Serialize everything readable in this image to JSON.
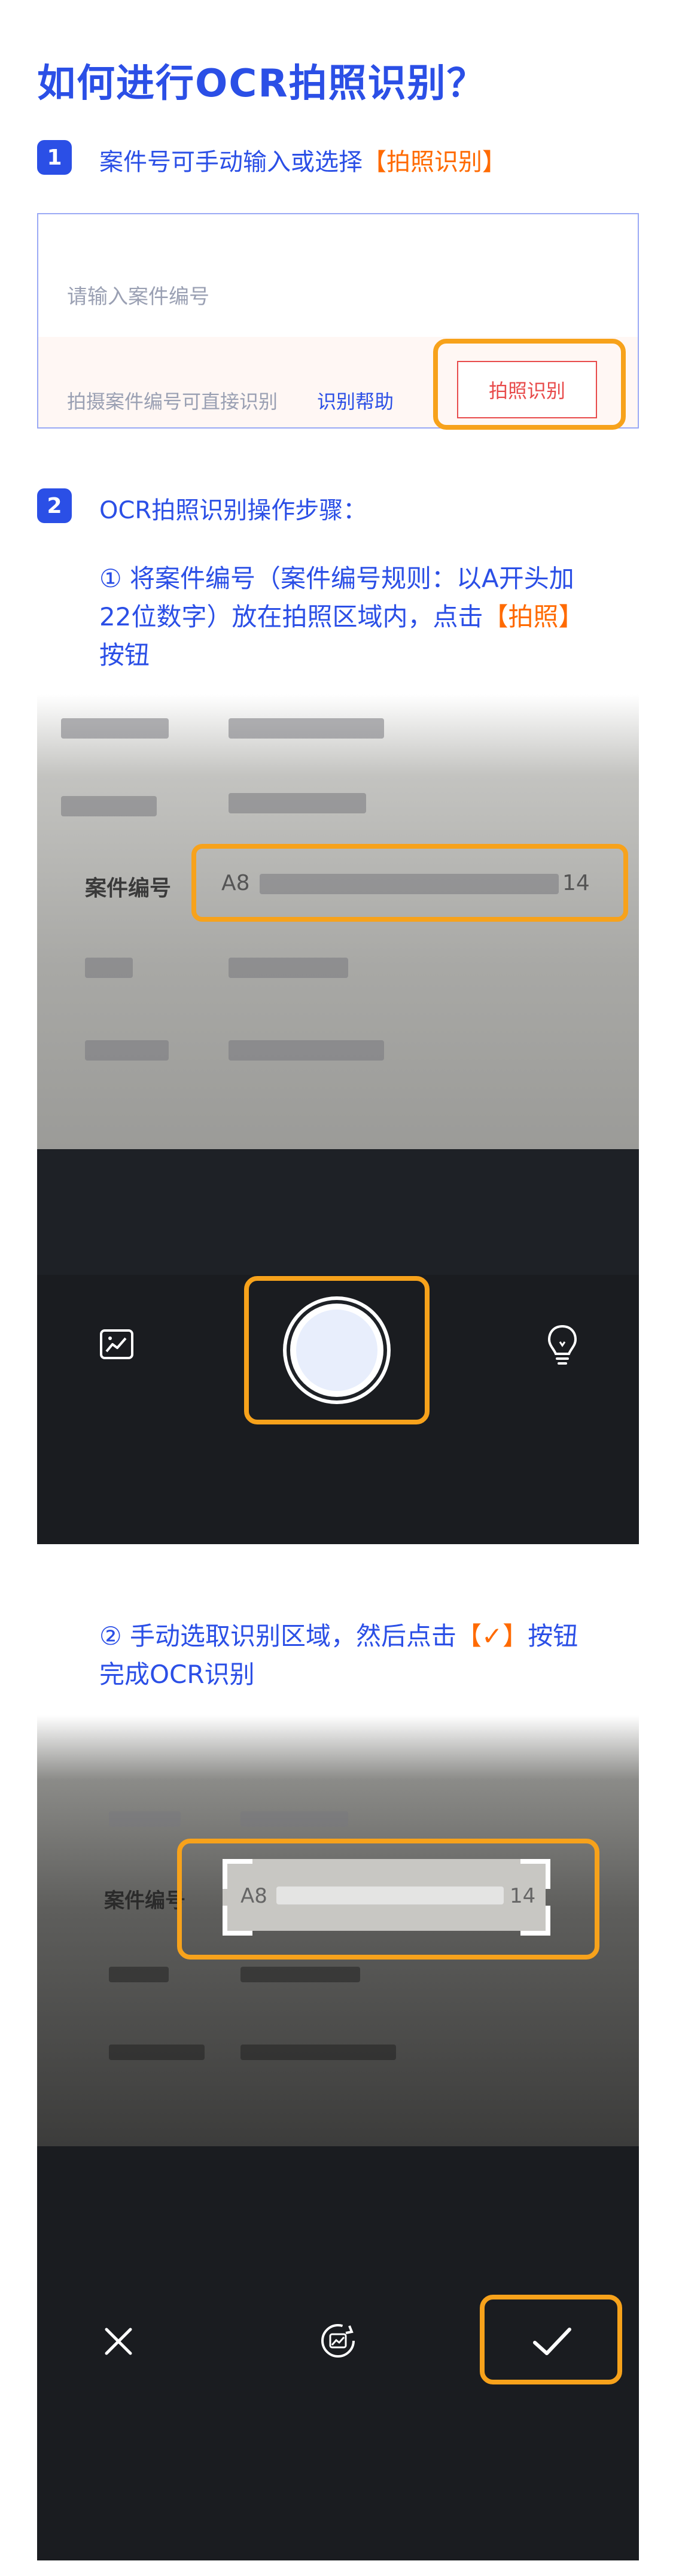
{
  "title": "如何进行OCR拍照识别？",
  "step1": {
    "badge": "1",
    "text_prefix": "案件号可手动输入或选择",
    "text_highlight": "【拍照识别】"
  },
  "form": {
    "placeholder": "请输入案件编号",
    "hint": "拍摄案件编号可直接识别",
    "help_link": "识别帮助",
    "photo_button": "拍照识别"
  },
  "step2": {
    "badge": "2",
    "text": "OCR拍照识别操作步骤："
  },
  "substep1": {
    "line1": "① 将案件编号（案件编号规则：以A开头加",
    "line2_prefix": "22位数字）放在拍照区域内，点击",
    "line2_highlight": "【拍照】",
    "line3": "按钮"
  },
  "shot1": {
    "label_case_number": "案件编号",
    "field_prefix": "A8",
    "field_suffix": "14",
    "icons": [
      "gallery-icon",
      "shutter-button",
      "flashlight-icon"
    ]
  },
  "substep2": {
    "line1_prefix": "② 手动选取识别区域，然后点击",
    "line1_highlight": "【✓】",
    "line1_suffix": "按钮",
    "line2": "完成OCR识别"
  },
  "shot2": {
    "label_case_number": "案件编号",
    "field_prefix": "A8",
    "field_suffix": "14",
    "icons": [
      "close-icon",
      "rotate-icon",
      "check-icon"
    ]
  },
  "colors": {
    "primary": "#2b4fe6",
    "highlight": "#ff6a00",
    "frame": "#f7a21b",
    "button_red": "#e84b4b"
  }
}
